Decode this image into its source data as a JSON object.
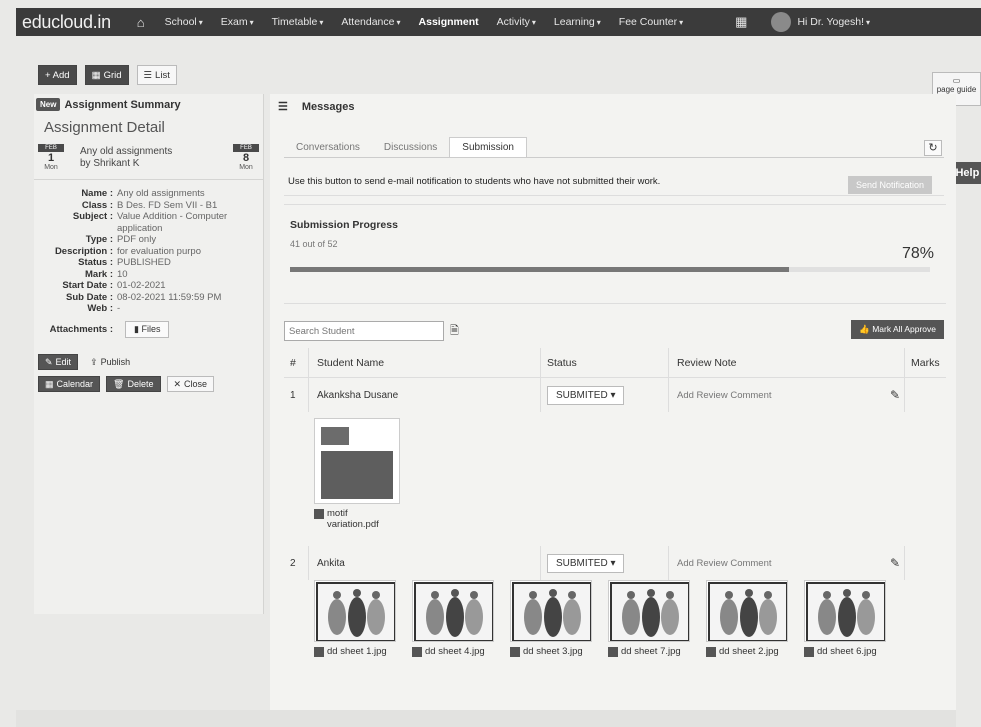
{
  "navbar": {
    "brand": "educloud.in",
    "home_icon": "home-icon",
    "items": [
      {
        "label": "School",
        "caret": true
      },
      {
        "label": "Exam",
        "caret": true
      },
      {
        "label": "Timetable",
        "caret": true
      },
      {
        "label": "Attendance",
        "caret": true
      },
      {
        "label": "Assignment",
        "caret": false,
        "active": true
      },
      {
        "label": "Activity",
        "caret": true
      },
      {
        "label": "Learning",
        "caret": true
      },
      {
        "label": "Fee Counter",
        "caret": true
      }
    ],
    "grid_icon": "grid-icon",
    "user": "Hi Dr. Yogesh!"
  },
  "toolbar": {
    "add": "+ Add",
    "grid": "Grid",
    "list": "List"
  },
  "page_guide": "page guide",
  "help": "Help",
  "summary": {
    "badge": "New",
    "heading": "Assignment Summary",
    "title": "Assignment Detail",
    "from": {
      "month": "FEB",
      "day": "1",
      "wd": "Mon"
    },
    "to": {
      "month": "FEB",
      "day": "8",
      "wd": "Mon"
    },
    "assignment_name": "Any old assignments",
    "by": "by Shrikant K",
    "details": [
      {
        "label": "Name :",
        "value": "Any old assignments"
      },
      {
        "label": "Class :",
        "value": "B Des. FD Sem VII - B1"
      },
      {
        "label": "Subject :",
        "value": "Value Addition - Computer application"
      },
      {
        "label": "Type :",
        "value": "PDF only"
      },
      {
        "label": "Description :",
        "value": "for evaluation purpo"
      },
      {
        "label": "Status :",
        "value": "PUBLISHED"
      },
      {
        "label": "Mark :",
        "value": "10"
      },
      {
        "label": "Start Date :",
        "value": "01-02-2021"
      },
      {
        "label": "Sub Date :",
        "value": "08-02-2021 11:59:59 PM"
      },
      {
        "label": "Web :",
        "value": "-"
      }
    ],
    "attachments_label": "Attachments :",
    "files_btn": "Files",
    "edit": "Edit",
    "publish": "Publish",
    "calendar": "Calendar",
    "delete": "Delete",
    "close": "Close"
  },
  "messages": {
    "title": "Messages",
    "tabs": [
      "Conversations",
      "Discussions",
      "Submission"
    ],
    "active_tab": 2,
    "notify_text": "Use this button to send e-mail notification to students who have not submitted their work.",
    "notify_btn": "Send Notification",
    "progress_title": "Submission Progress",
    "progress_count": "41 out of 52",
    "progress_pct": "78%",
    "progress_value": 0.78,
    "search_placeholder": "Search Student",
    "mark_all": "Mark All Approve",
    "columns": [
      "#",
      "Student Name",
      "Status",
      "Review Note",
      "Marks"
    ],
    "rows": [
      {
        "num": "1",
        "name": "Akanksha Dusane",
        "status": "SUBMITED",
        "note": "Add Review Comment",
        "attachments": [
          {
            "label": "motif variation.pdf",
            "kind": "pdf"
          }
        ]
      },
      {
        "num": "2",
        "name": "Ankita",
        "status": "SUBMITED",
        "note": "Add Review Comment",
        "attachments": [
          {
            "label": "dd sheet 1.jpg",
            "kind": "img"
          },
          {
            "label": "dd sheet 4.jpg",
            "kind": "img"
          },
          {
            "label": "dd sheet 3.jpg",
            "kind": "img"
          },
          {
            "label": "dd sheet 7.jpg",
            "kind": "img"
          },
          {
            "label": "dd sheet 2.jpg",
            "kind": "img"
          },
          {
            "label": "dd sheet 6.jpg",
            "kind": "img"
          }
        ]
      }
    ]
  }
}
